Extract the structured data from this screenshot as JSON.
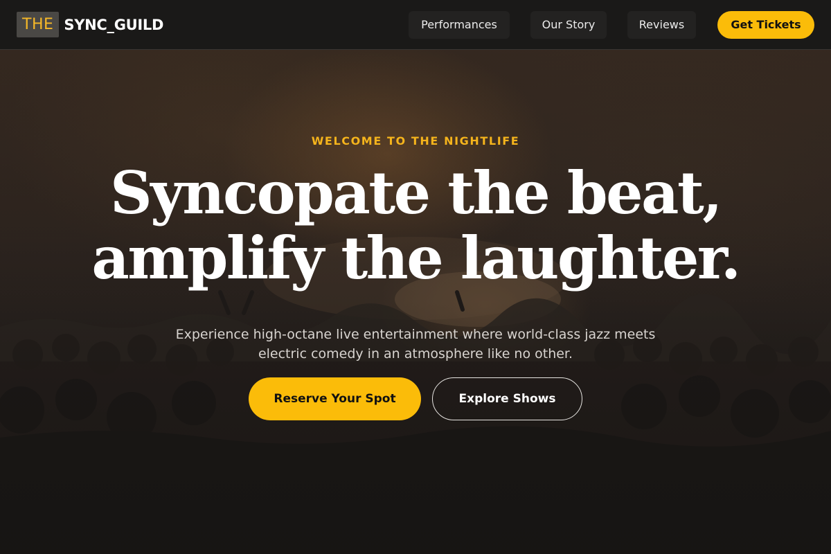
{
  "header": {
    "logo": {
      "badge": "THE",
      "name": "SYNC_GUILD"
    },
    "nav": [
      {
        "label": "Performances"
      },
      {
        "label": "Our Story"
      },
      {
        "label": "Reviews"
      }
    ],
    "cta_label": "Get Tickets"
  },
  "hero": {
    "eyebrow": "WELCOME TO THE NIGHTLIFE",
    "headline_line1": "Syncopate the beat,",
    "headline_line2": "amplify the laughter.",
    "subtitle": "Experience high-octane live entertainment where world-class jazz meets electric comedy in an atmosphere like no other.",
    "primary_button": "Reserve Your Spot",
    "secondary_button": "Explore Shows",
    "background_image": "concert-crowd-photo"
  },
  "colors": {
    "accent": "#fbbc09",
    "header_bg": "#1a1918",
    "nav_pill_bg": "#232221",
    "text_primary": "#ffffff",
    "text_secondary": "#d8d4d0",
    "logo_badge_bg": "#4a4845"
  }
}
